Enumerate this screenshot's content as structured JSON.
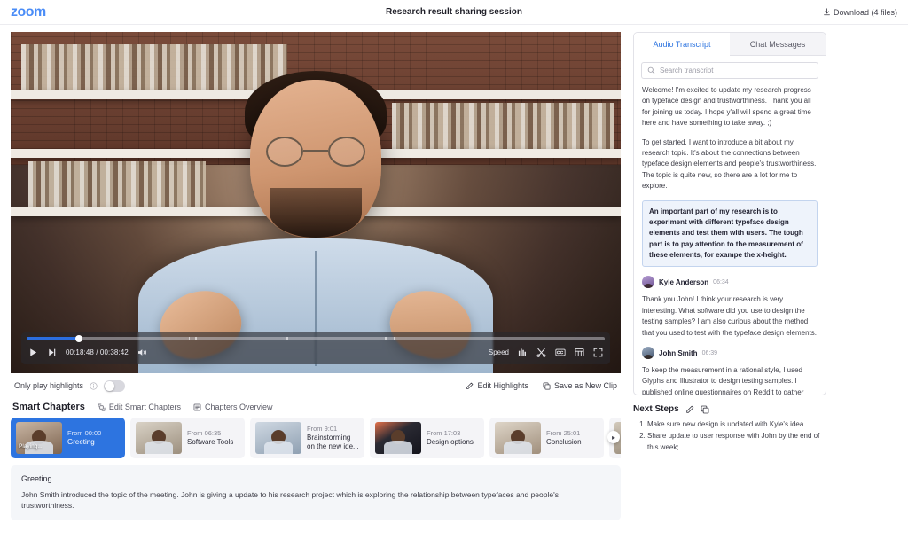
{
  "topbar": {
    "logo": "zoom",
    "title": "Research result sharing session",
    "download_label": "Download (4 files)"
  },
  "player": {
    "current_time": "00:18:48",
    "total_time": "00:38:42",
    "time_display": "00:18:48 / 00:38:42",
    "progress_percent": 9,
    "speed_label": "Speed",
    "accent_color": "#2b6ee0"
  },
  "highlights_bar": {
    "toggle_label": "Only play highlights",
    "toggle_on": false,
    "edit_highlights": "Edit Highlights",
    "save_as_new_clip": "Save as New Clip"
  },
  "smart_chapters": {
    "title": "Smart Chapters",
    "edit_label": "Edit Smart Chapters",
    "overview_label": "Chapters Overview",
    "playing_tag": "Playing...",
    "items": [
      {
        "from": "From 00:00",
        "name": "Greeting",
        "active": true,
        "thumb": "tb1"
      },
      {
        "from": "From 06:35",
        "name": "Software Tools",
        "active": false,
        "thumb": "tb2"
      },
      {
        "from": "From 9:01",
        "name": "Brainstorming on the new ide...",
        "active": false,
        "thumb": "tb3"
      },
      {
        "from": "From 17:03",
        "name": "Design options",
        "active": false,
        "thumb": "tb4"
      },
      {
        "from": "From 25:01",
        "name": "Conclusion",
        "active": false,
        "thumb": "tb5"
      },
      {
        "from": "",
        "name": "",
        "active": false,
        "thumb": "tb6"
      }
    ]
  },
  "summary": {
    "title": "Greeting",
    "body": "John Smith introduced the topic of the meeting. John is giving a  update to his research project which is exploring the relationship between typefaces and people's trustworthiness."
  },
  "transcript": {
    "tabs": [
      {
        "label": "Audio Transcript",
        "active": true
      },
      {
        "label": "Chat Messages",
        "active": false
      }
    ],
    "search_placeholder": "Search transcript",
    "search_value": "",
    "paragraphs": [
      "Welcome! I'm excited to update my research progress on typeface design and trustworthiness. Thank you all for joining us today. I hope y'all will spend a great time here and have something to take away. ;)",
      "To get started, I want to introduce a bit about my research topic. It's about the connections between typeface design elements and people's trustworthiness. The topic is quite new, so there are a lot for me to explore."
    ],
    "highlighted": "An important part of my research is to experiment with different typeface design elements and test them with users. The tough part is to pay attention to the measurement of these elements, for exampe the x-height.",
    "entries": [
      {
        "speaker": "Kyle Anderson",
        "time": "06:34",
        "text": "Thank you John! I think your research is very interesting. What software did you use to design the testing samples? I am also curious about the method that you used to test with the typeface design elements."
      },
      {
        "speaker": "John Smith",
        "time": "06:39",
        "text": "To keep the measurement in a rational style, I used Glyphs and Illustrator to design testing samples. I published online questionnaires on Reddit to gather results and it went well!"
      }
    ]
  },
  "next_steps": {
    "title": "Next Steps",
    "items": [
      "Make sure new design is updated with Kyle's idea.",
      "Share update to user response with John by the end of this week;"
    ]
  },
  "icons": {
    "download": "download-icon",
    "play": "play-icon",
    "next": "skip-next-icon",
    "volume": "volume-icon",
    "audio_levels": "audio-levels-icon",
    "scissors": "scissors-icon",
    "closed_caption": "cc-icon",
    "layout": "layout-grid-icon",
    "fullscreen": "fullscreen-icon",
    "info": "info-icon",
    "pencil": "pencil-icon",
    "copy": "copy-icon",
    "edit_chapters": "edit-chapters-icon",
    "overview": "list-overview-icon",
    "search": "search-icon"
  }
}
